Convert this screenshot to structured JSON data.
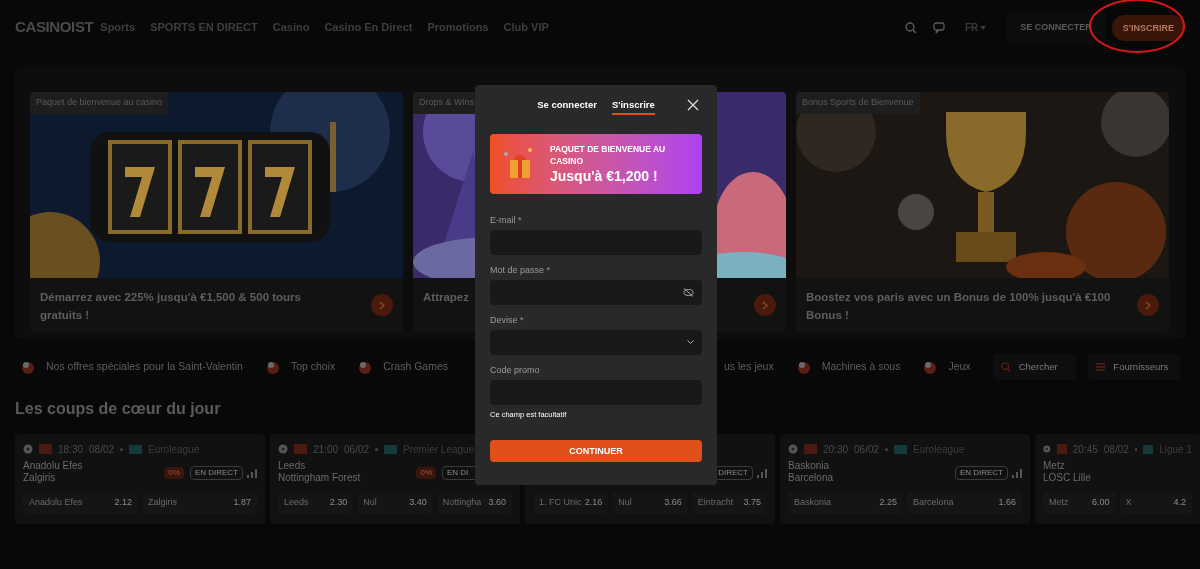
{
  "header": {
    "logo": "CASINOIST",
    "nav": [
      {
        "label": "Sports"
      },
      {
        "label": "SPORTS EN DIRECT"
      },
      {
        "label": "Casino"
      },
      {
        "label": "Casino En Direct"
      },
      {
        "label": "Promotions"
      },
      {
        "label": "Club VIP"
      }
    ],
    "language": "FR",
    "login": "SE CONNECTER",
    "signup": "S'INSCRIRE"
  },
  "banners": [
    {
      "tag": "Paquet de bienvenue au casino",
      "caption": "Démarrez avec 225% jusqu'à €1,500 & 500 tours gratuits !",
      "kind": "slot"
    },
    {
      "tag": "Drops & Wins",
      "caption": "Attrapez",
      "kind": "fantasy"
    },
    {
      "tag": "Bonus Sports de Bienvenue",
      "caption": "Boostez vos paris avec un Bonus de 100% jusqu'à €100 Bonus !",
      "kind": "trophy"
    }
  ],
  "categories": [
    {
      "label": "Nos offres spéciales pour la Saint-Valentin",
      "kind": "full"
    },
    {
      "label": "Top choix",
      "kind": "full"
    },
    {
      "label": "Crash Games",
      "kind": "full"
    },
    {
      "label": "us les jeux",
      "kind": "clipped"
    },
    {
      "label": "Machines à sous",
      "kind": "full"
    },
    {
      "label": "Jeux",
      "kind": "full"
    }
  ],
  "search_button": "Chercher",
  "providers_button": "Fournisseurs",
  "section_title": "Les coups de cœur du jour",
  "matches": [
    {
      "time": "18:30",
      "date": "08/02",
      "league": "Euroleague",
      "home": "Anadolu Efes",
      "away": "Zalgiris",
      "boost": "0%",
      "live": "EN DIRECT",
      "odds": [
        {
          "label": "Anadolu Efes",
          "value": "2.12"
        },
        {
          "label": "Zalgiris",
          "value": "1.87"
        }
      ]
    },
    {
      "time": "21:00",
      "date": "06/02",
      "league": "Premier League",
      "home": "Leeds",
      "away": "Nottingham Forest",
      "boost": "0%",
      "live": "EN DI",
      "kind": "clipend",
      "odds": [
        {
          "label": "Leeds",
          "value": "2.30"
        },
        {
          "label": "Nul",
          "value": "3.40"
        },
        {
          "label": "Nottingha",
          "value": "3.60"
        }
      ]
    },
    {
      "live": "DIRECT",
      "kind": "clipstart",
      "odds": [
        {
          "label": "1. FC Unic",
          "value": "2.16"
        },
        {
          "label": "Nul",
          "value": "3.66"
        },
        {
          "label": "Eintracht",
          "value": "3.75"
        }
      ]
    },
    {
      "time": "20:30",
      "date": "06/02",
      "league": "Euroleague",
      "home": "Baskonia",
      "away": "Barcelona",
      "live": "EN DIRECT",
      "odds": [
        {
          "label": "Baskonia",
          "value": "2.25"
        },
        {
          "label": "Barcelona",
          "value": "1.66"
        }
      ]
    },
    {
      "time": "20:45",
      "date": "08/02",
      "league": "Ligue 1",
      "home": "Metz",
      "away": "LOSC Lille",
      "odds": [
        {
          "label": "Metz",
          "value": "6.00"
        },
        {
          "label": "X",
          "value": "4.2"
        }
      ]
    }
  ],
  "modal": {
    "tabs": [
      {
        "label": "Se connecter",
        "selected": false
      },
      {
        "label": "S'inscrire",
        "selected": true
      }
    ],
    "promo": {
      "title": "PAQUET DE BIENVENUE AU CASINO",
      "amount": "Jusqu'à €1,200 !"
    },
    "fields": [
      {
        "label": "E-mail *",
        "kind": "text"
      },
      {
        "label": "Mot de passe *",
        "kind": "password"
      },
      {
        "label": "Devise *",
        "kind": "select"
      },
      {
        "label": "Code promo",
        "kind": "text",
        "hint": "Ce champ est facultatif"
      }
    ],
    "submit": "CONTINUER"
  }
}
